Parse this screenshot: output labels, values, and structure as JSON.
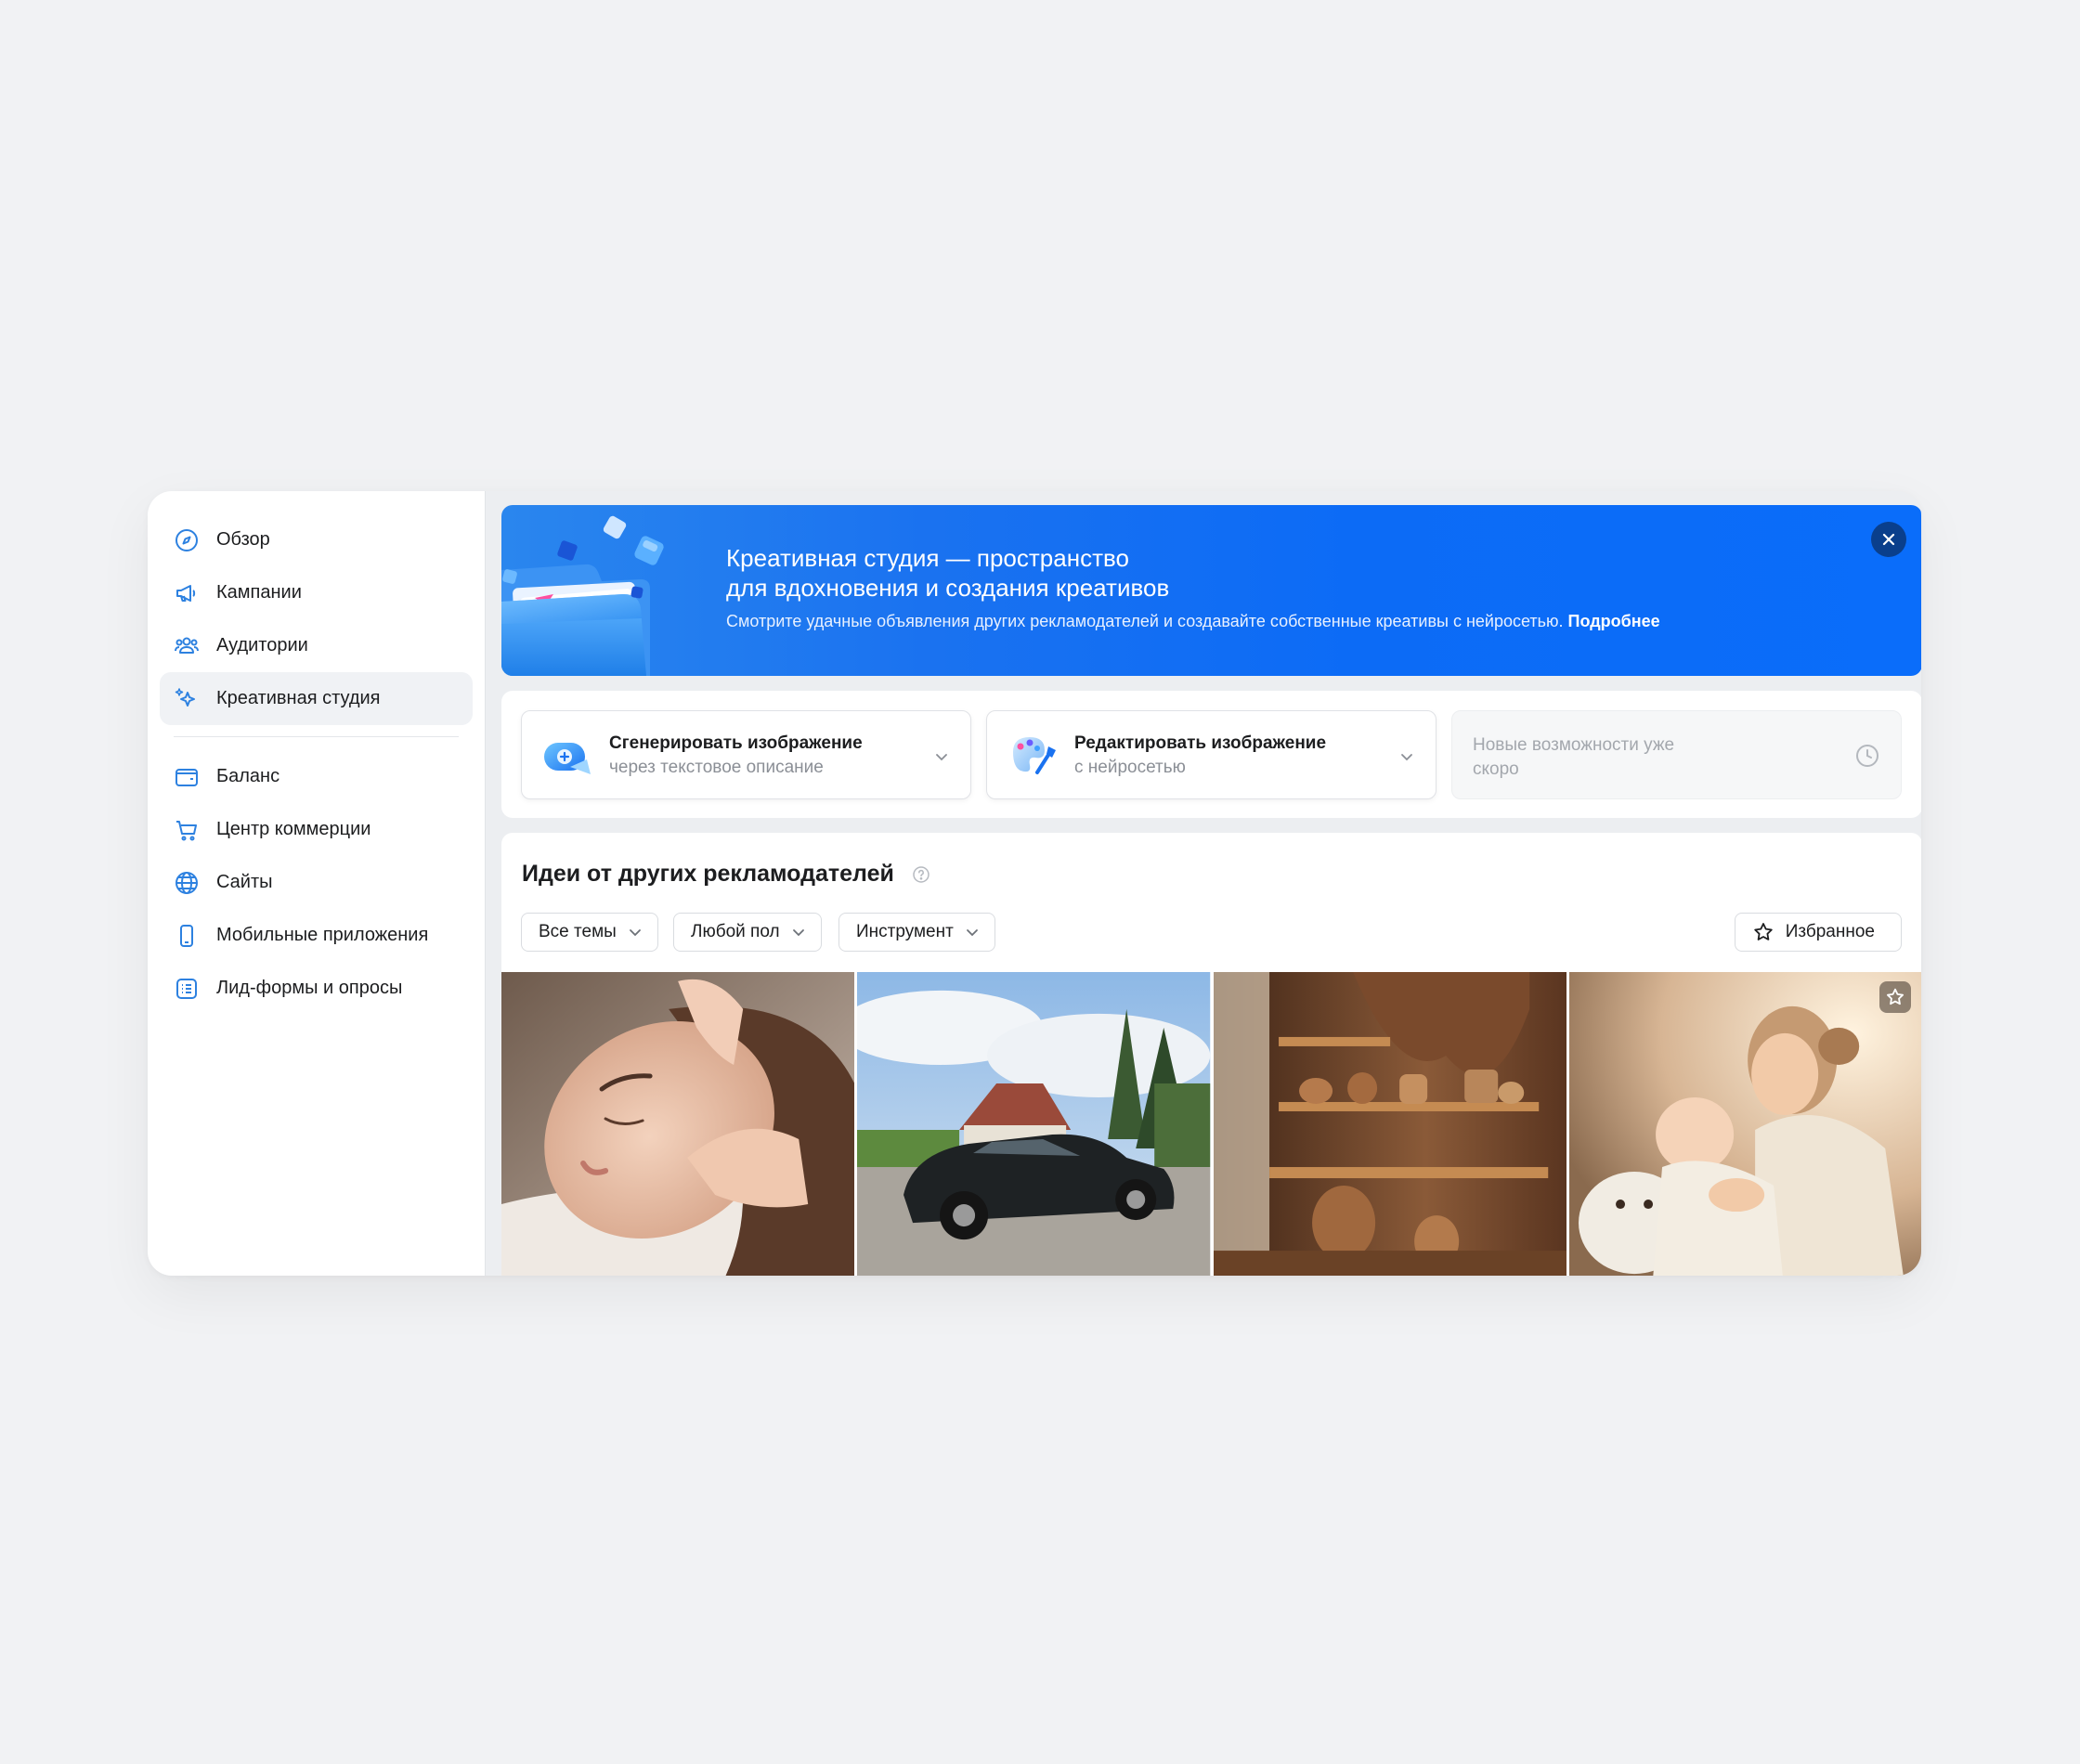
{
  "sidebar": {
    "items": [
      {
        "label": "Обзор",
        "icon": "compass-icon"
      },
      {
        "label": "Кампании",
        "icon": "megaphone-icon"
      },
      {
        "label": "Аудитории",
        "icon": "users-icon"
      },
      {
        "label": "Креативная студия",
        "icon": "sparkles-icon",
        "active": true
      },
      {
        "label": "Баланс",
        "icon": "wallet-icon"
      },
      {
        "label": "Центр коммерции",
        "icon": "cart-icon"
      },
      {
        "label": "Сайты",
        "icon": "globe-icon"
      },
      {
        "label": "Мобильные приложения",
        "icon": "smartphone-icon"
      },
      {
        "label": "Лид-формы и опросы",
        "icon": "list-form-icon"
      }
    ]
  },
  "banner": {
    "title_line1": "Креативная студия — пространство",
    "title_line2": "для вдохновения и создания креативов",
    "description": "Смотрите удачные объявления других рекламодателей и создавайте собственные креативы с нейросетью.",
    "link": "Подробнее",
    "close_icon": "close-icon"
  },
  "tools": [
    {
      "title": "Сгенерировать изображение",
      "subtitle": "через текстовое описание",
      "icon": "generate-image-icon"
    },
    {
      "title": "Редактировать изображение",
      "subtitle": "с нейросетью",
      "icon": "edit-image-icon"
    },
    {
      "title": "Новые возможности уже скоро",
      "icon": "clock-icon",
      "disabled": true
    }
  ],
  "ideas": {
    "title": "Идеи от других рекламодателей",
    "filters": [
      "Все темы",
      "Любой пол",
      "Инструмент"
    ],
    "favorites_label": "Избранное",
    "images": [
      {
        "name": "facial-massage-image"
      },
      {
        "name": "black-suv-image"
      },
      {
        "name": "pottery-shelves-image"
      },
      {
        "name": "mother-and-baby-image"
      }
    ]
  },
  "colors": {
    "accent": "#0a6dfa",
    "icon_blue": "#2d81e0",
    "page_bg": "#f1f2f4"
  }
}
